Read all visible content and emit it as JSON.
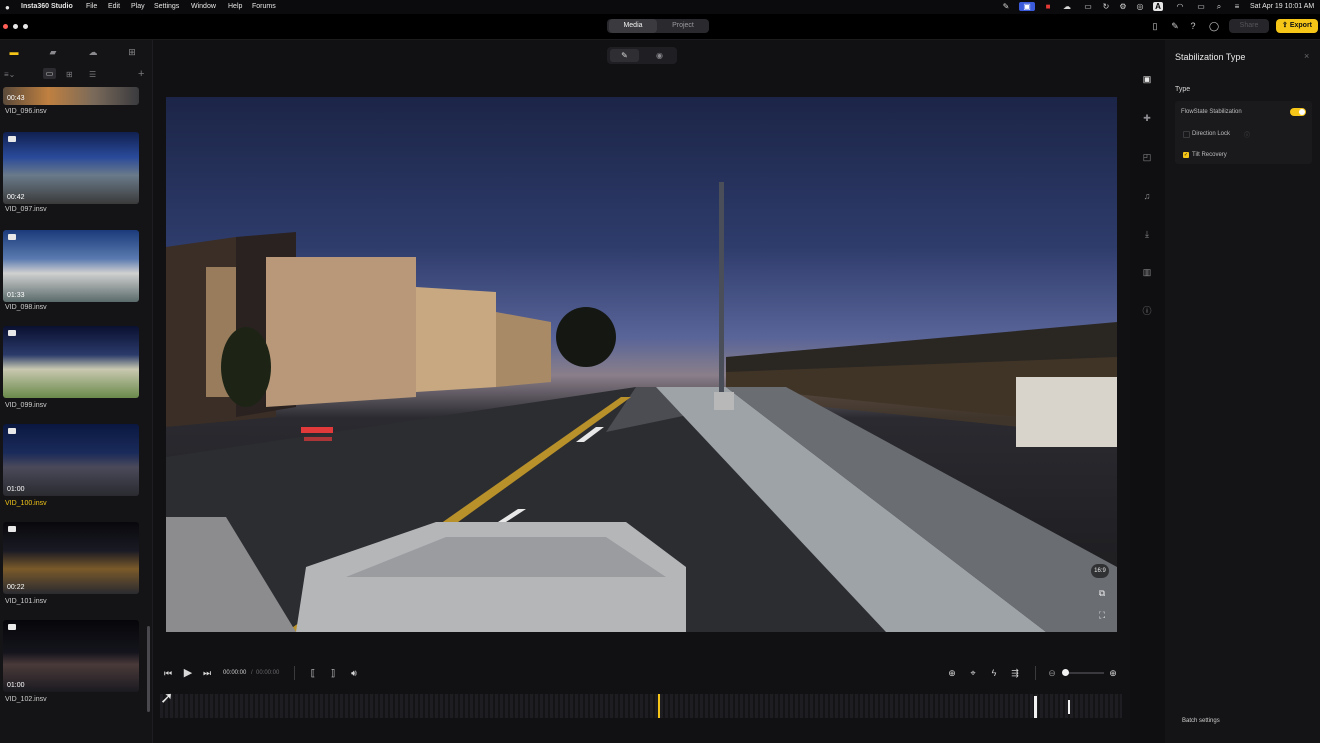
{
  "menubar": {
    "app_name": "Insta360 Studio",
    "menus": [
      "File",
      "Edit",
      "Play",
      "Settings",
      "Window",
      "Help",
      "Forums"
    ],
    "datetime": "Sat Apr 19  10:01 AM"
  },
  "toolbar": {
    "tab_media": "Media",
    "tab_project": "Project",
    "export_label": "Export",
    "share_label": "Share"
  },
  "clips": [
    {
      "duration": "00:43",
      "name": "VID_096.insv"
    },
    {
      "duration": "00:42",
      "name": "VID_097.insv"
    },
    {
      "duration": "01:33",
      "name": "VID_098.insv"
    },
    {
      "duration": "",
      "name": "VID_099.insv"
    },
    {
      "duration": "01:00",
      "name": "VID_100.insv"
    },
    {
      "duration": "00:22",
      "name": "VID_101.insv"
    },
    {
      "duration": "01:00",
      "name": "VID_102.insv"
    }
  ],
  "player": {
    "time_current": "00:00:00",
    "time_total": "00:00:00",
    "aspect_ratio": "16:9"
  },
  "stabilization": {
    "panel_title": "Stabilization Type",
    "section_label": "Type",
    "flowstate_label": "FlowState Stabilization",
    "flowstate_on": true,
    "direction_lock_label": "Direction Lock",
    "direction_lock_checked": false,
    "tilt_recovery_label": "Tilt Recovery",
    "tilt_recovery_checked": true
  },
  "footer": {
    "batch_settings_label": "Batch settings"
  },
  "colors": {
    "accent": "#f5c518",
    "selected_clip_name": "#f0c419",
    "toolbar_bg": "#000000",
    "panel_bg": "#141416"
  }
}
